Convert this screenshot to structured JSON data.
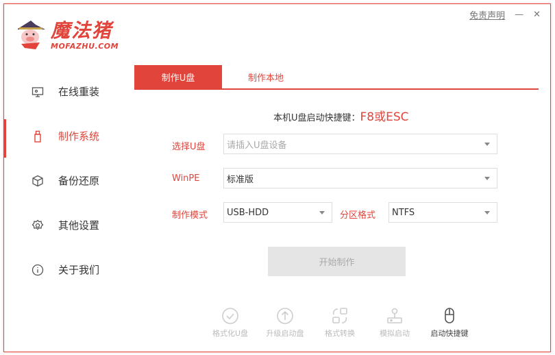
{
  "header": {
    "brand_cn": "魔法猪",
    "brand_en": "MOFAZHU.COM",
    "disclaimer": "免责声明",
    "minimize": "—",
    "close": "✕"
  },
  "sidebar": {
    "items": [
      {
        "label": "在线重装",
        "icon": "monitor-icon"
      },
      {
        "label": "制作系统",
        "icon": "usb-icon",
        "active": true
      },
      {
        "label": "备份还原",
        "icon": "cube-icon"
      },
      {
        "label": "其他设置",
        "icon": "gear-icon"
      },
      {
        "label": "关于我们",
        "icon": "info-icon"
      }
    ]
  },
  "tabs": [
    {
      "label": "制作U盘",
      "active": true
    },
    {
      "label": "制作本地"
    }
  ],
  "hotkey": {
    "label": "本机U盘启动快捷键：",
    "value": "F8或ESC"
  },
  "form": {
    "usb_label": "选择U盘",
    "usb_placeholder": "请插入U盘设备",
    "winpe_label": "WinPE",
    "winpe_value": "标准版",
    "mode_label": "制作模式",
    "mode_value": "USB-HDD",
    "partition_label": "分区格式",
    "partition_value": "NTFS",
    "start_button": "开始制作"
  },
  "tools": [
    {
      "label": "格式化U盘",
      "icon": "check-circle-icon"
    },
    {
      "label": "升级启动盘",
      "icon": "arrow-up-circle-icon"
    },
    {
      "label": "格式转换",
      "icon": "convert-icon"
    },
    {
      "label": "模拟启动",
      "icon": "joystick-icon"
    },
    {
      "label": "启动快捷键",
      "icon": "mouse-icon"
    }
  ],
  "colors": {
    "accent": "#e0443a",
    "disabled": "#e5e5e5"
  }
}
